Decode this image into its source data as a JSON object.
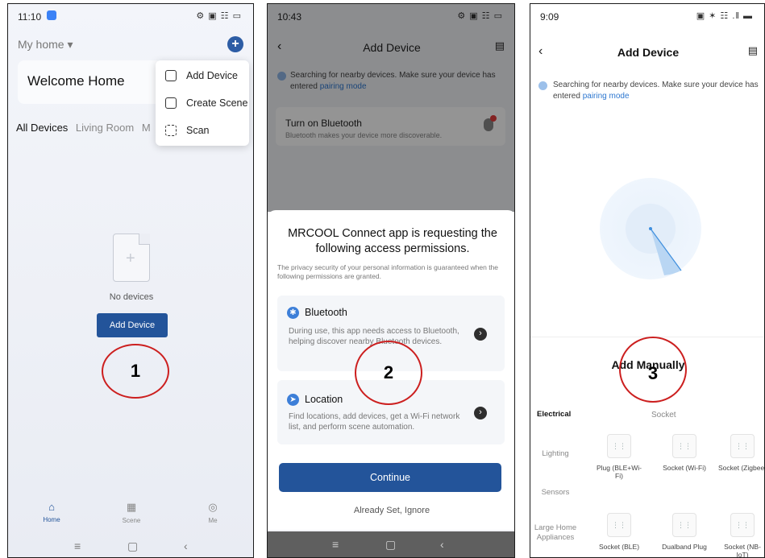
{
  "panel1": {
    "status_time": "11:10",
    "status_icons": "⚙ ▣ ☷ ▭",
    "home_label": "My home ▾",
    "plus_icon": "+",
    "welcome": "Welcome Home",
    "menu": [
      {
        "label": "Add Device"
      },
      {
        "label": "Create Scene"
      },
      {
        "label": "Scan"
      }
    ],
    "tabs": [
      "All Devices",
      "Living Room",
      "M"
    ],
    "no_devices": "No devices",
    "add_device_button": "Add Device",
    "step_number": "1",
    "tabbar": [
      {
        "label": "Home",
        "icon": "⌂"
      },
      {
        "label": "Scene",
        "icon": "▦"
      },
      {
        "label": "Me",
        "icon": "◎"
      }
    ],
    "nav": [
      "≡",
      "▢",
      "‹"
    ]
  },
  "panel2": {
    "status_time": "10:43",
    "status_icons": "⚙ ▣ ☷ ▭",
    "title": "Add Device",
    "search_text": "Searching for nearby devices. Make sure your device has entered",
    "search_link": "pairing mode",
    "bluetooth_card_title": "Turn on Bluetooth",
    "bluetooth_card_sub": "Bluetooth makes your device more discoverable.",
    "permission_title": "MRCOOL Connect app is requesting the following access permissions.",
    "permission_desc": "The privacy security of your personal information is guaranteed when the following permissions are granted.",
    "permissions": [
      {
        "title": "Bluetooth",
        "text": "During use, this app needs access to Bluetooth, helping discover nearby Bluetooth devices."
      },
      {
        "title": "Location",
        "text": "Find locations, add devices, get a Wi-Fi network list, and perform scene automation."
      }
    ],
    "continue_button": "Continue",
    "ignore_link": "Already Set, Ignore",
    "step_number": "2",
    "nav": [
      "≡",
      "▢",
      "‹"
    ]
  },
  "panel3": {
    "status_time": "9:09",
    "status_icons": "▣ ✶ ☷ .‖ ▬",
    "title": "Add Device",
    "search_text": "Searching for nearby devices. Make sure your device has entered",
    "search_link": "pairing mode",
    "add_manually": "Add Manually",
    "step_number": "3",
    "categories": [
      "Electrical",
      "Lighting",
      "Sensors",
      "Large Home Appliances"
    ],
    "socket_header": "Socket",
    "devices": [
      {
        "label": "Plug (BLE+Wi-Fi)"
      },
      {
        "label": "Socket (Wi-Fi)"
      },
      {
        "label": "Socket (Zigbee)"
      },
      {
        "label": "Socket (BLE)"
      },
      {
        "label": "Dualband Plug"
      },
      {
        "label": "Socket (NB-IoT)"
      }
    ]
  }
}
